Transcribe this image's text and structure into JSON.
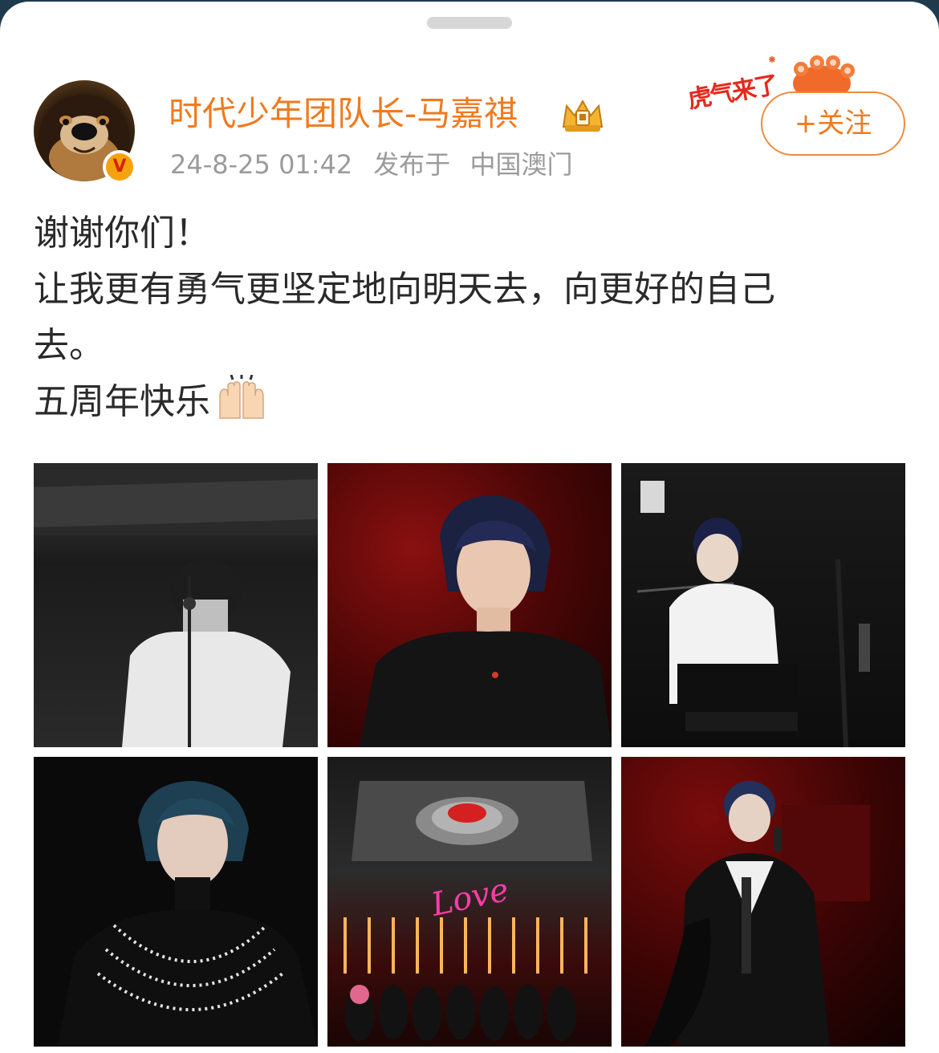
{
  "post": {
    "author": {
      "name": "时代少年团队长-马嘉祺",
      "verified_badge": "V",
      "timestamp": "24-8-25 01:42",
      "location_prefix": "发布于",
      "location": "中国澳门"
    },
    "decoration_text": "虎气来了",
    "follow_button": "+关注",
    "lines": [
      "谢谢你们！",
      "让我更有勇气更坚定地向明天去，向更好的自己",
      "去。",
      "五周年快乐"
    ],
    "emoji": "raising-hands-emoji",
    "photos": [
      {
        "label": "photo-1",
        "tone": "grayscale"
      },
      {
        "label": "photo-2",
        "tone": "red"
      },
      {
        "label": "photo-3",
        "tone": "dark"
      },
      {
        "label": "photo-4",
        "tone": "dark"
      },
      {
        "label": "photo-5",
        "tone": "stage"
      },
      {
        "label": "photo-6",
        "tone": "red"
      }
    ],
    "photo_overlay_text": "Love"
  },
  "colors": {
    "accent": "#f07a1e",
    "meta_text": "#9b9b9b",
    "body_text": "#2a2a2a",
    "badge": "#f6a20f"
  }
}
